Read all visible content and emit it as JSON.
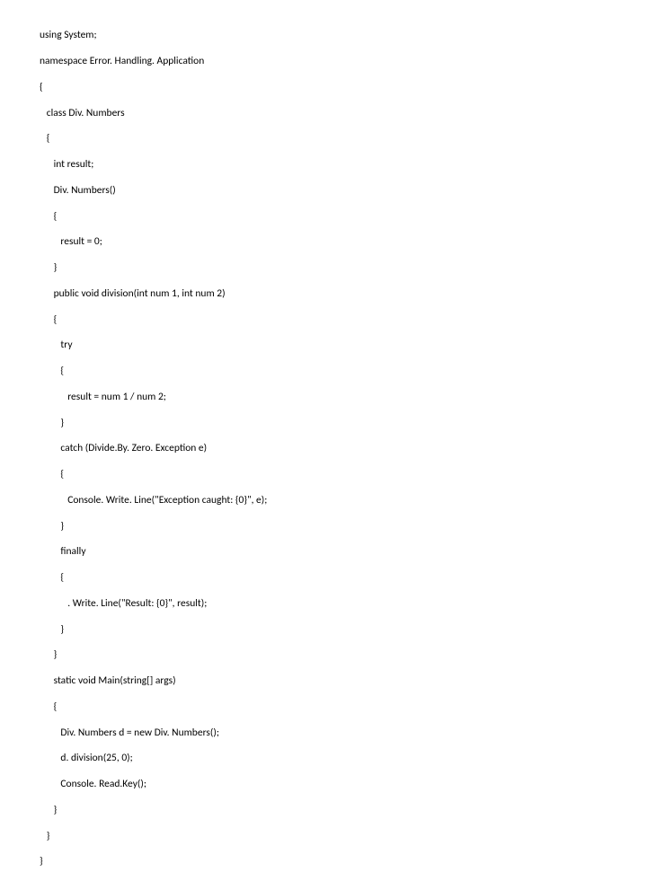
{
  "code": {
    "lines": [
      "using System;",
      "namespace Error. Handling. Application",
      "{",
      "   class Div. Numbers",
      "   {",
      "      int result;",
      "      Div. Numbers()",
      "      {",
      "         result = 0;",
      "      }",
      "      public void division(int num 1, int num 2)",
      "      {",
      "         try",
      "         {",
      "            result = num 1 / num 2;",
      "         }",
      "         catch (Divide.By. Zero. Exception e)",
      "         {",
      "            Console. Write. Line(\"Exception caught: {0}\", e);",
      "         }",
      "         finally",
      "         {",
      "            . Write. Line(\"Result: {0}\", result);",
      "         }",
      "      }",
      "      static void Main(string[] args)",
      "      {",
      "         Div. Numbers d = new Div. Numbers();",
      "         d. division(25, 0);",
      "         Console. Read.Key();",
      "      }",
      "   }",
      "}"
    ]
  }
}
